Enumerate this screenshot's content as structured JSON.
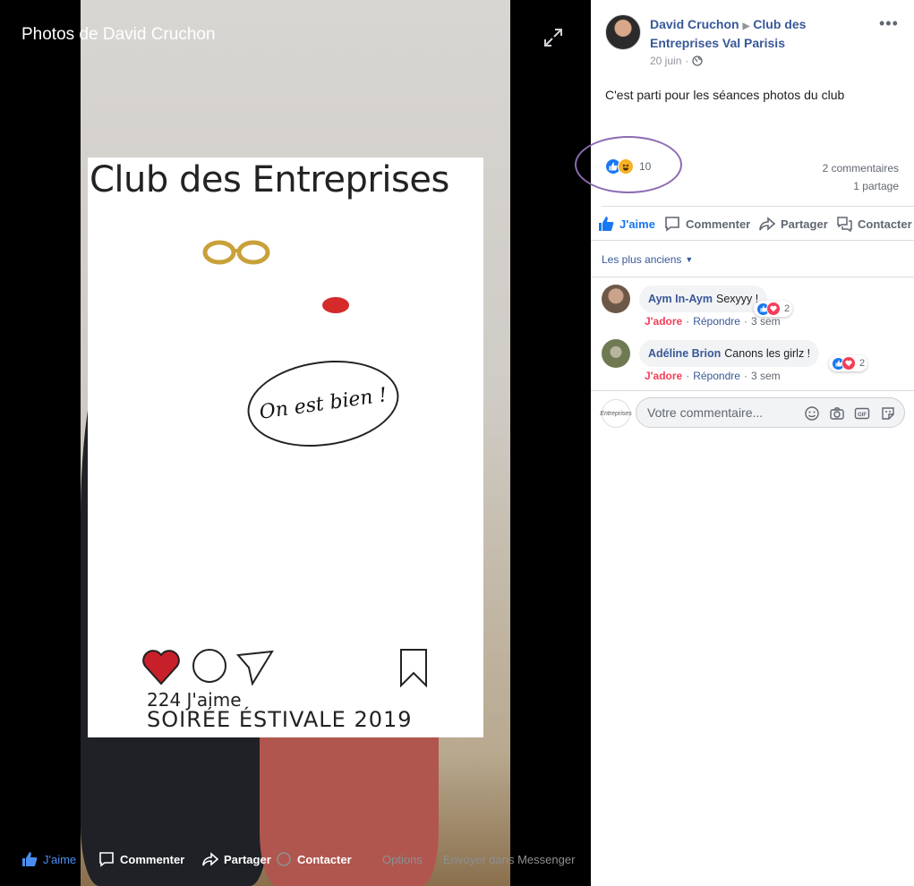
{
  "viewer": {
    "title": "Photos de David Cruchon",
    "photo": {
      "frame_title": "Club des Entreprises",
      "bubble_text": "On est bien !",
      "likes_text": "224 J'aime",
      "event_text": "SOIRÉE ÉSTIVALE 2019"
    },
    "actions": {
      "like": "J'aime",
      "comment": "Commenter",
      "share": "Partager",
      "contact": "Contacter",
      "options": "Options",
      "messenger": "Envoyer dans Messenger"
    }
  },
  "post": {
    "author": "David Cruchon",
    "group": "Club des Entreprises Val Parisis",
    "date": "20 juin",
    "date_separator": "·",
    "text": "C'est parti pour les séances photos du club",
    "reactions_count": "10",
    "comments_count": "2 commentaires",
    "shares_count": "1 partage",
    "actions": {
      "like": "J'aime",
      "comment": "Commenter",
      "share": "Partager",
      "contact": "Contacter"
    },
    "sort_label": "Les plus anciens",
    "comments": [
      {
        "name": "Aym In-Aym",
        "text": "Sexyyy !",
        "reactions": "2",
        "adore": "J'adore",
        "reply": "Répondre",
        "time": "3 sem"
      },
      {
        "name": "Adéline Brion",
        "text": "Canons les girlz !",
        "reactions": "2",
        "adore": "J'adore",
        "reply": "Répondre",
        "time": "3 sem"
      }
    ],
    "page_avatar_text": "Entreprises",
    "comment_placeholder": "Votre commentaire..."
  },
  "colors": {
    "link_blue": "#385898",
    "like_blue": "#1877f2",
    "love_red": "#f33e58",
    "annotation_purple": "#8c6bb1"
  }
}
